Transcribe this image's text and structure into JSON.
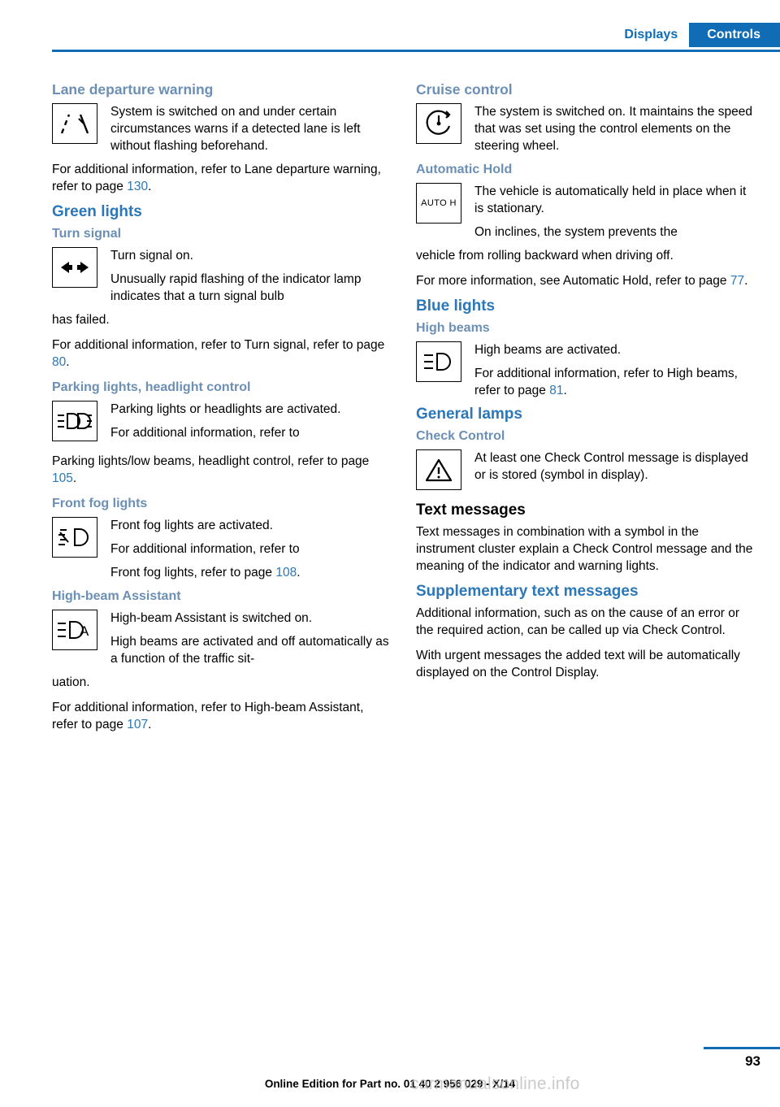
{
  "header": {
    "tab_displays": "Displays",
    "tab_controls": "Controls",
    "accent_color": "#0f6cb5"
  },
  "left": {
    "lane_departure": {
      "heading": "Lane departure warning",
      "icon_name": "lane-departure-warning-icon",
      "icon_text": "System is switched on and under certain circumstances warns if a detected lane is left without flashing beforehand.",
      "para_pre": "For additional information, refer to Lane departure warning, refer to page ",
      "page_ref": "130",
      "para_post": "."
    },
    "green_lights": {
      "heading": "Green lights"
    },
    "turn_signal": {
      "heading": "Turn signal",
      "icon_name": "turn-signal-arrows-icon",
      "icon_text_1": "Turn signal on.",
      "icon_text_2": "Unusually rapid flashing of the indicator lamp indicates that a turn signal bulb",
      "after_icon": "has failed.",
      "para_pre": "For additional information, refer to Turn signal, refer to page ",
      "page_ref": "80",
      "para_post": "."
    },
    "parking_lights": {
      "heading": "Parking lights, headlight control",
      "icon_name": "parking-lights-headlight-icon",
      "icon_text_1": "Parking lights or headlights are activated.",
      "icon_text_2": "For additional information, refer to",
      "after_icon": "Parking lights/low beams, headlight control, refer to page ",
      "page_ref": "105",
      "para_post": "."
    },
    "front_fog": {
      "heading": "Front fog lights",
      "icon_name": "front-fog-lights-icon",
      "icon_text_1": "Front fog lights are activated.",
      "icon_text_2": "For additional information, refer to",
      "icon_text_3_pre": "Front fog lights, refer to page ",
      "page_ref": "108",
      "para_post": "."
    },
    "high_beam_assistant": {
      "heading": "High-beam Assistant",
      "icon_name": "high-beam-assistant-icon",
      "icon_text_1": "High-beam Assistant is switched on.",
      "icon_text_2": "High beams are activated and off automatically as a function of the traffic sit-",
      "after_icon": "uation.",
      "para_pre": "For additional information, refer to High-beam Assistant, refer to page ",
      "page_ref": "107",
      "para_post": "."
    }
  },
  "right": {
    "cruise_control": {
      "heading": "Cruise control",
      "icon_name": "cruise-control-icon",
      "icon_text": "The system is switched on. It maintains the speed that was set using the control elements on the steering wheel."
    },
    "automatic_hold": {
      "heading": "Automatic Hold",
      "icon_name": "automatic-hold-icon",
      "icon_label": "AUTO H",
      "icon_text_1": "The vehicle is automatically held in place when it is stationary.",
      "icon_text_2": "On inclines, the system prevents the",
      "after_icon": "vehicle from rolling backward when driving off.",
      "para_pre": "For more information, see Automatic Hold, refer to page ",
      "page_ref": "77",
      "para_post": "."
    },
    "blue_lights": {
      "heading": "Blue lights"
    },
    "high_beams": {
      "heading": "High beams",
      "icon_name": "high-beams-icon",
      "icon_text_1": "High beams are activated.",
      "icon_text_2_pre": "For additional information, refer to High beams, refer to page ",
      "page_ref": "81",
      "para_post": "."
    },
    "general_lamps": {
      "heading": "General lamps"
    },
    "check_control": {
      "heading": "Check Control",
      "icon_name": "check-control-warning-triangle-icon",
      "icon_text": "At least one Check Control message is displayed or is stored (symbol in display)."
    },
    "text_messages": {
      "heading": "Text messages",
      "body": "Text messages in combination with a symbol in the instrument cluster explain a Check Control message and the meaning of the indicator and warning lights."
    },
    "supplementary": {
      "heading": "Supplementary text messages",
      "body_1": "Additional information, such as on the cause of an error or the required action, can be called up via Check Control.",
      "body_2": "With urgent messages the added text will be automatically displayed on the Control Display."
    }
  },
  "footer": {
    "page_number": "93",
    "edition_line": "Online Edition for Part no. 01 40 2 956 029 - X/14",
    "watermark": "carmanualsonline.info"
  }
}
